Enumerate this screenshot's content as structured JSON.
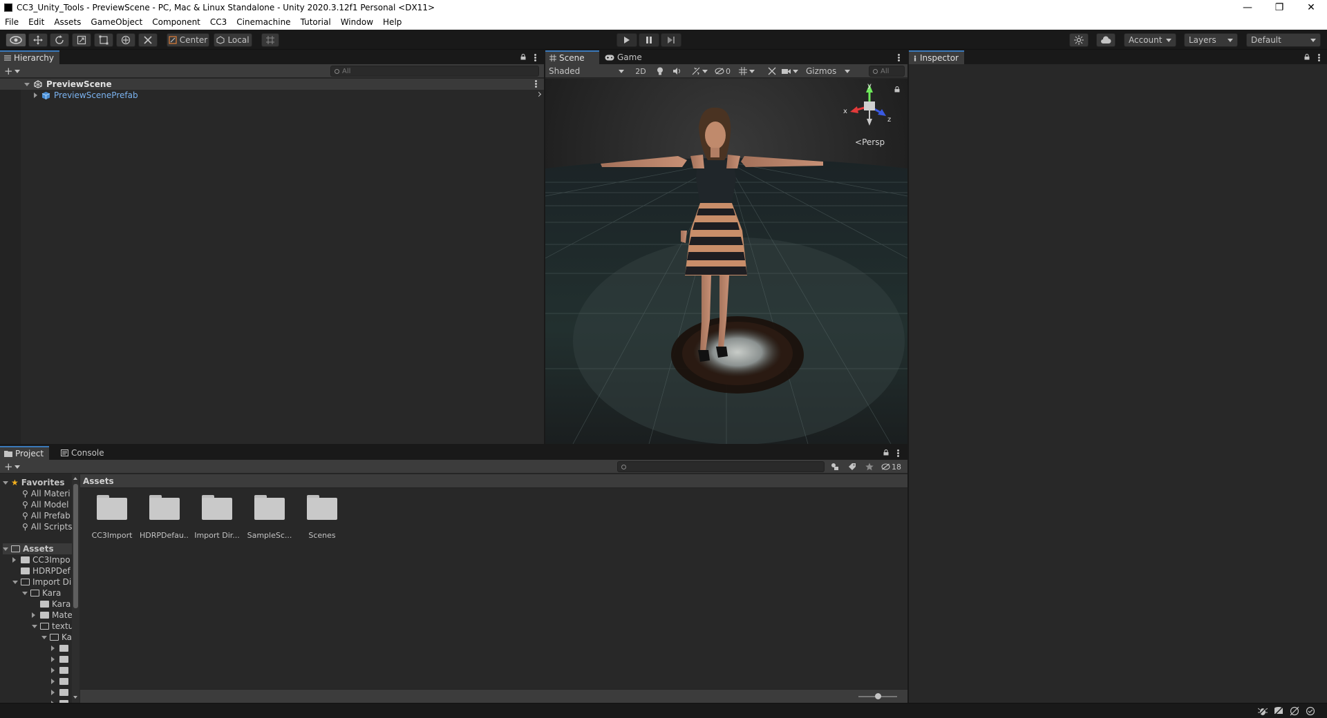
{
  "window": {
    "title": "CC3_Unity_Tools - PreviewScene - PC, Mac & Linux Standalone - Unity 2020.3.12f1 Personal <DX11>",
    "minimize": "—",
    "maximize": "❐",
    "close": "✕"
  },
  "menu": [
    "File",
    "Edit",
    "Assets",
    "GameObject",
    "Component",
    "CC3",
    "Cinemachine",
    "Tutorial",
    "Window",
    "Help"
  ],
  "toolbar": {
    "pivot_label": "Center",
    "space_label": "Local",
    "account_label": "Account",
    "layers_label": "Layers",
    "layout_label": "Default"
  },
  "hierarchy": {
    "tab_label": "Hierarchy",
    "add_label": "+",
    "search_placeholder": "All",
    "scene_name": "PreviewScene",
    "items": [
      {
        "label": "PreviewScenePrefab"
      }
    ]
  },
  "scene_view": {
    "tabs": [
      {
        "label": "Scene"
      },
      {
        "label": "Game"
      }
    ],
    "shading_mode": "Shaded",
    "mode_2d": "2D",
    "hidden_count": "0",
    "gizmos_label": "Gizmos",
    "search_placeholder": "All",
    "persp_label": "Persp",
    "axis_labels": {
      "x": "x",
      "y": "y",
      "z": "z"
    }
  },
  "inspector": {
    "tab_label": "Inspector"
  },
  "project": {
    "tabs": [
      {
        "label": "Project"
      },
      {
        "label": "Console"
      }
    ],
    "add_label": "+",
    "hidden_count": "18",
    "breadcrumb": "Assets",
    "favorites_label": "Favorites",
    "favorites": [
      "All Materi",
      "All Model",
      "All Prefab",
      "All Scripts"
    ],
    "assets_label": "Assets",
    "tree": [
      {
        "label": "CC3Impo",
        "depth": 1,
        "expanded": false
      },
      {
        "label": "HDRPDef",
        "depth": 1,
        "expanded": null
      },
      {
        "label": "Import Di",
        "depth": 1,
        "expanded": true
      },
      {
        "label": "Kara",
        "depth": 2,
        "expanded": true
      },
      {
        "label": "Kara",
        "depth": 3,
        "expanded": null
      },
      {
        "label": "Mate",
        "depth": 3,
        "expanded": false
      },
      {
        "label": "textu",
        "depth": 3,
        "expanded": true
      },
      {
        "label": "Ka",
        "depth": 4,
        "expanded": true
      },
      {
        "label": "",
        "depth": 5,
        "expanded": false
      },
      {
        "label": "",
        "depth": 5,
        "expanded": false
      },
      {
        "label": "",
        "depth": 5,
        "expanded": false
      },
      {
        "label": "",
        "depth": 5,
        "expanded": false
      },
      {
        "label": "",
        "depth": 5,
        "expanded": false
      },
      {
        "label": "",
        "depth": 5,
        "expanded": false
      }
    ],
    "folders": [
      {
        "label": "CC3Import"
      },
      {
        "label": "HDRPDefau..."
      },
      {
        "label": "Import Dir..."
      },
      {
        "label": "SampleSc..."
      },
      {
        "label": "Scenes"
      }
    ]
  },
  "colors": {
    "accent": "#3a79bb",
    "prefab_text": "#7bb3f0",
    "panel_bg": "#282828"
  }
}
